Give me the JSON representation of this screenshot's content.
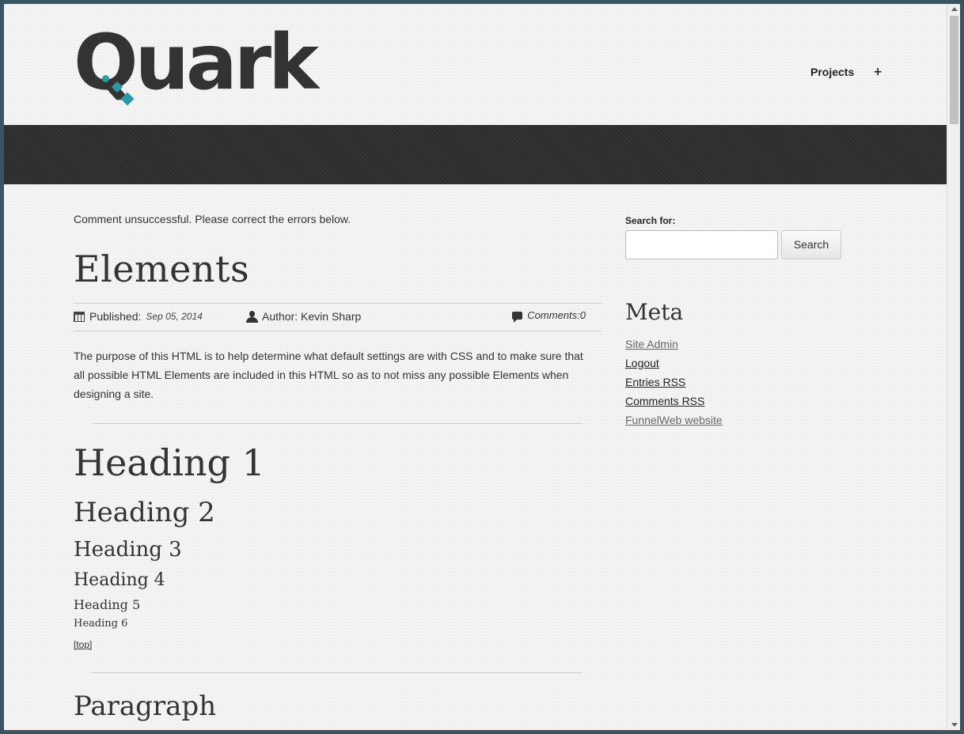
{
  "header": {
    "logo_text": "Quark",
    "nav": {
      "projects_label": "Projects",
      "plus_label": "+"
    }
  },
  "main": {
    "flash_message": "Comment unsuccessful. Please correct the errors below.",
    "post_title": "Elements",
    "meta": {
      "published_label": "Published:",
      "published_date": "Sep 05, 2014",
      "author_label": "Author: Kevin Sharp",
      "comments_label": "Comments:0"
    },
    "intro": "The purpose of this HTML is to help determine what default settings are with CSS and to make sure that all possible HTML Elements are included in this HTML so as to not miss any possible Elements when designing a site.",
    "headings": {
      "h1": "Heading 1",
      "h2": "Heading 2",
      "h3": "Heading 3",
      "h4": "Heading 4",
      "h5": "Heading 5",
      "h6": "Heading 6"
    },
    "top_link": "[top]",
    "paragraph_title": "Paragraph"
  },
  "sidebar": {
    "search_label": "Search for:",
    "search_value": "",
    "search_button": "Search",
    "meta_title": "Meta",
    "meta_links": [
      "Site Admin",
      "Logout",
      "Entries RSS",
      "Comments RSS",
      "FunnelWeb website"
    ]
  },
  "colors": {
    "accent": "#2a9aa9",
    "band": "#2d2d2d",
    "text": "#333333"
  }
}
